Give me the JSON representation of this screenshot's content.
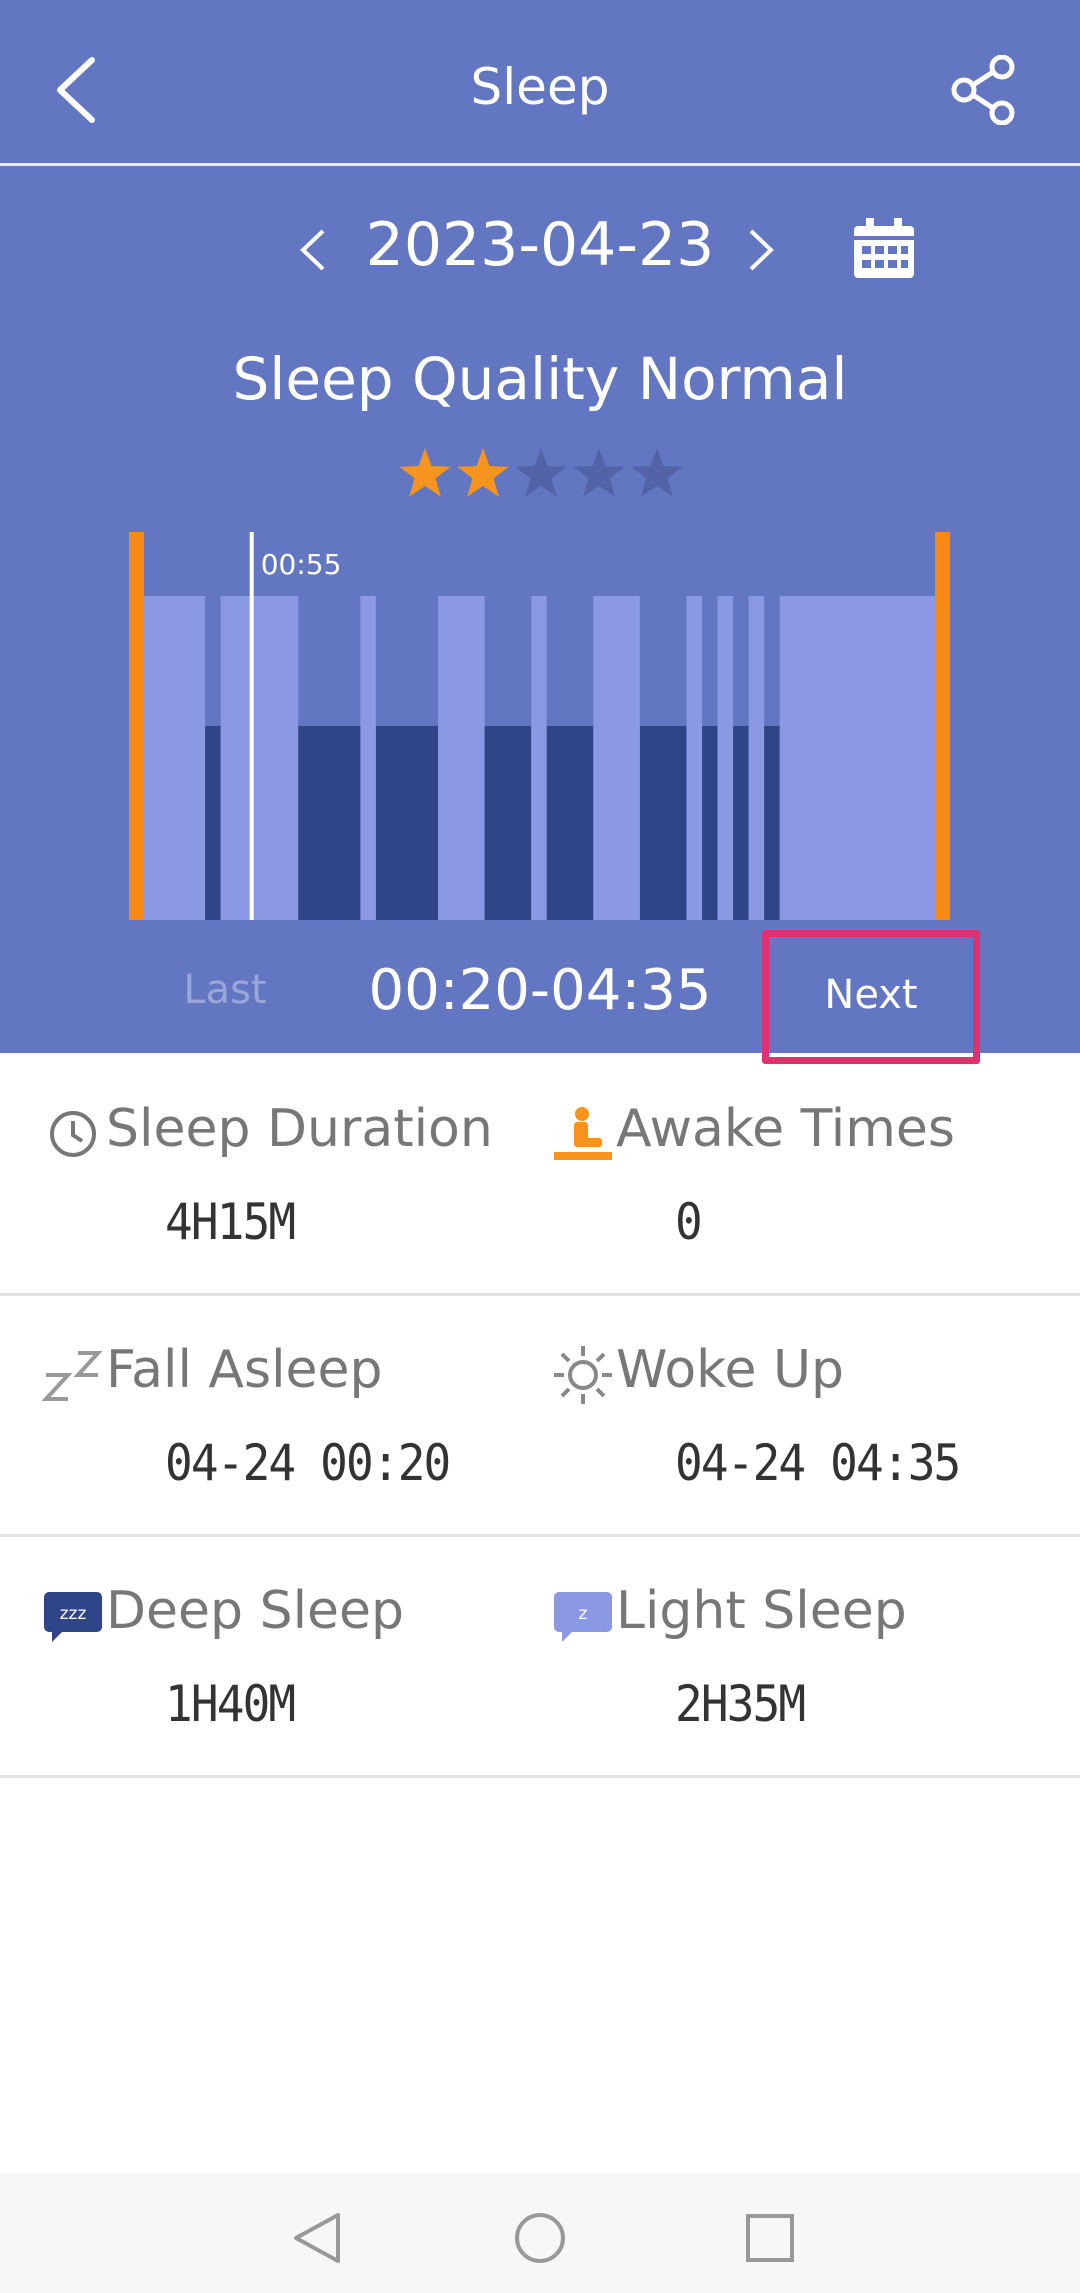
{
  "header": {
    "title": "Sleep",
    "date": "2023-04-23",
    "quality_text": "Sleep Quality Normal",
    "rating": 2,
    "rating_max": 5,
    "cursor_label": "00:55",
    "last_label": "Last",
    "time_range": "00:20-04:35",
    "next_label": "Next"
  },
  "colors": {
    "header_bg": "#6376c1",
    "light_sleep": "#8b99e4",
    "deep_sleep": "#2f4587",
    "awake_marker": "#fa8a13",
    "star_on": "#f7941d",
    "star_off": "#5263a8",
    "highlight": "#e0306e"
  },
  "icons": {
    "back": "chevron-left-icon",
    "share": "share-icon",
    "calendar": "calendar-icon",
    "date_prev": "chevron-left-icon",
    "date_next": "chevron-right-icon",
    "sleep_duration": "clock-icon",
    "awake_times": "awake-person-icon",
    "fall_asleep": "zzz-icon",
    "woke_up": "sun-icon",
    "deep_sleep": "deep-sleep-badge-icon",
    "light_sleep": "light-sleep-badge-icon"
  },
  "stats": [
    [
      {
        "key": "sleep_duration",
        "label": "Sleep Duration",
        "value": "4H15M"
      },
      {
        "key": "awake_times",
        "label": "Awake Times",
        "value": "0"
      }
    ],
    [
      {
        "key": "fall_asleep",
        "label": "Fall Asleep",
        "value": "04-24 00:20"
      },
      {
        "key": "woke_up",
        "label": "Woke Up",
        "value": "04-24 04:35"
      }
    ],
    [
      {
        "key": "deep_sleep",
        "label": "Deep Sleep",
        "value": "1H40M"
      },
      {
        "key": "light_sleep",
        "label": "Light Sleep",
        "value": "2H35M"
      }
    ]
  ],
  "chart_data": {
    "type": "bar",
    "x_unit": "minutes since 00:20",
    "x_range": [
      0,
      255
    ],
    "cursor_minute": 35,
    "segments": [
      {
        "stage": "light",
        "start": 0,
        "end": 20
      },
      {
        "stage": "deep",
        "start": 20,
        "end": 25
      },
      {
        "stage": "light",
        "start": 25,
        "end": 50
      },
      {
        "stage": "deep",
        "start": 50,
        "end": 70
      },
      {
        "stage": "light",
        "start": 70,
        "end": 75
      },
      {
        "stage": "deep",
        "start": 75,
        "end": 95
      },
      {
        "stage": "light",
        "start": 95,
        "end": 110
      },
      {
        "stage": "deep",
        "start": 110,
        "end": 125
      },
      {
        "stage": "light",
        "start": 125,
        "end": 130
      },
      {
        "stage": "deep",
        "start": 130,
        "end": 145
      },
      {
        "stage": "light",
        "start": 145,
        "end": 160
      },
      {
        "stage": "deep",
        "start": 160,
        "end": 175
      },
      {
        "stage": "light",
        "start": 175,
        "end": 180
      },
      {
        "stage": "deep",
        "start": 180,
        "end": 185
      },
      {
        "stage": "light",
        "start": 185,
        "end": 190
      },
      {
        "stage": "deep",
        "start": 190,
        "end": 195
      },
      {
        "stage": "light",
        "start": 195,
        "end": 200
      },
      {
        "stage": "deep",
        "start": 200,
        "end": 205
      },
      {
        "stage": "light",
        "start": 205,
        "end": 255
      }
    ]
  }
}
